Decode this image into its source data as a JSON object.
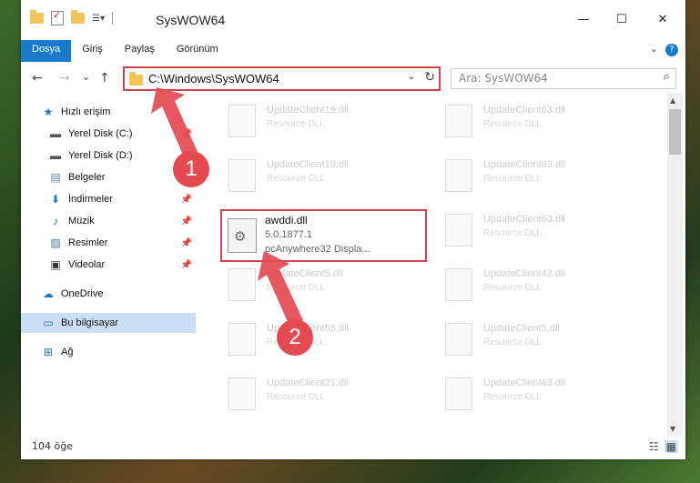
{
  "window": {
    "title": "SysWOW64",
    "minimize": "—",
    "maximize": "☐",
    "close": "✕"
  },
  "ribbon": {
    "tabs": [
      "Dosya",
      "Giriş",
      "Paylaş",
      "Görünüm"
    ],
    "help": "?"
  },
  "nav": {
    "back": "←",
    "forward": "→",
    "recent": "⌄",
    "up": "↑",
    "address": "C:\\Windows\\SysWOW64",
    "refresh": "↻",
    "search_placeholder": "Ara: SysWOW64"
  },
  "sidebar": {
    "items": [
      {
        "label": "Hızlı erişim",
        "icon": "star-icon",
        "pinned": false
      },
      {
        "label": "Yerel Disk (C:)",
        "icon": "drive-icon",
        "pinned": true
      },
      {
        "label": "Yerel Disk (D:)",
        "icon": "drive-icon",
        "pinned": false
      },
      {
        "label": "Belgeler",
        "icon": "documents-icon",
        "pinned": true
      },
      {
        "label": "İndirmeler",
        "icon": "downloads-icon",
        "pinned": true
      },
      {
        "label": "Müzik",
        "icon": "music-icon",
        "pinned": true
      },
      {
        "label": "Resimler",
        "icon": "pictures-icon",
        "pinned": true
      },
      {
        "label": "Videolar",
        "icon": "videos-icon",
        "pinned": true
      },
      {
        "label": "OneDrive",
        "icon": "cloud-icon",
        "pinned": false
      },
      {
        "label": "Bu bilgisayar",
        "icon": "computer-icon",
        "pinned": false
      },
      {
        "label": "Ağ",
        "icon": "network-icon",
        "pinned": false
      }
    ]
  },
  "files": {
    "left": [
      {
        "name": "UpdateClient19.dll",
        "desc": "Resource DLL"
      },
      {
        "name": "UpdateClient19.dll",
        "desc": "Resource DLL"
      },
      {
        "name": "UpdateClient5.dll",
        "desc": "Resource DLL"
      },
      {
        "name": "UpdateClient65.dll",
        "desc": "Resource DLL"
      },
      {
        "name": "UpdateClient21.dll",
        "desc": "Resource DLL"
      }
    ],
    "right": [
      {
        "name": "UpdateClient63.dll",
        "desc": "Resource DLL"
      },
      {
        "name": "UpdateClient63.dll",
        "desc": "Resource DLL"
      },
      {
        "name": "UpdateClient63.dll",
        "desc": "Resource DLL"
      },
      {
        "name": "UpdateClient42.dll",
        "desc": "Resource DLL"
      },
      {
        "name": "UpdateClient5.dll",
        "desc": "Resource DLL"
      },
      {
        "name": "UpdateClient63.dll",
        "desc": "Resource DLL"
      }
    ],
    "highlighted": {
      "name": "awddi.dll",
      "version": "5.0.1877.1",
      "desc": "pcAnywhere32 Displa..."
    }
  },
  "status": {
    "count": "104 öğe"
  },
  "annotations": {
    "step1": "1",
    "step2": "2",
    "color": "#e34a52"
  }
}
